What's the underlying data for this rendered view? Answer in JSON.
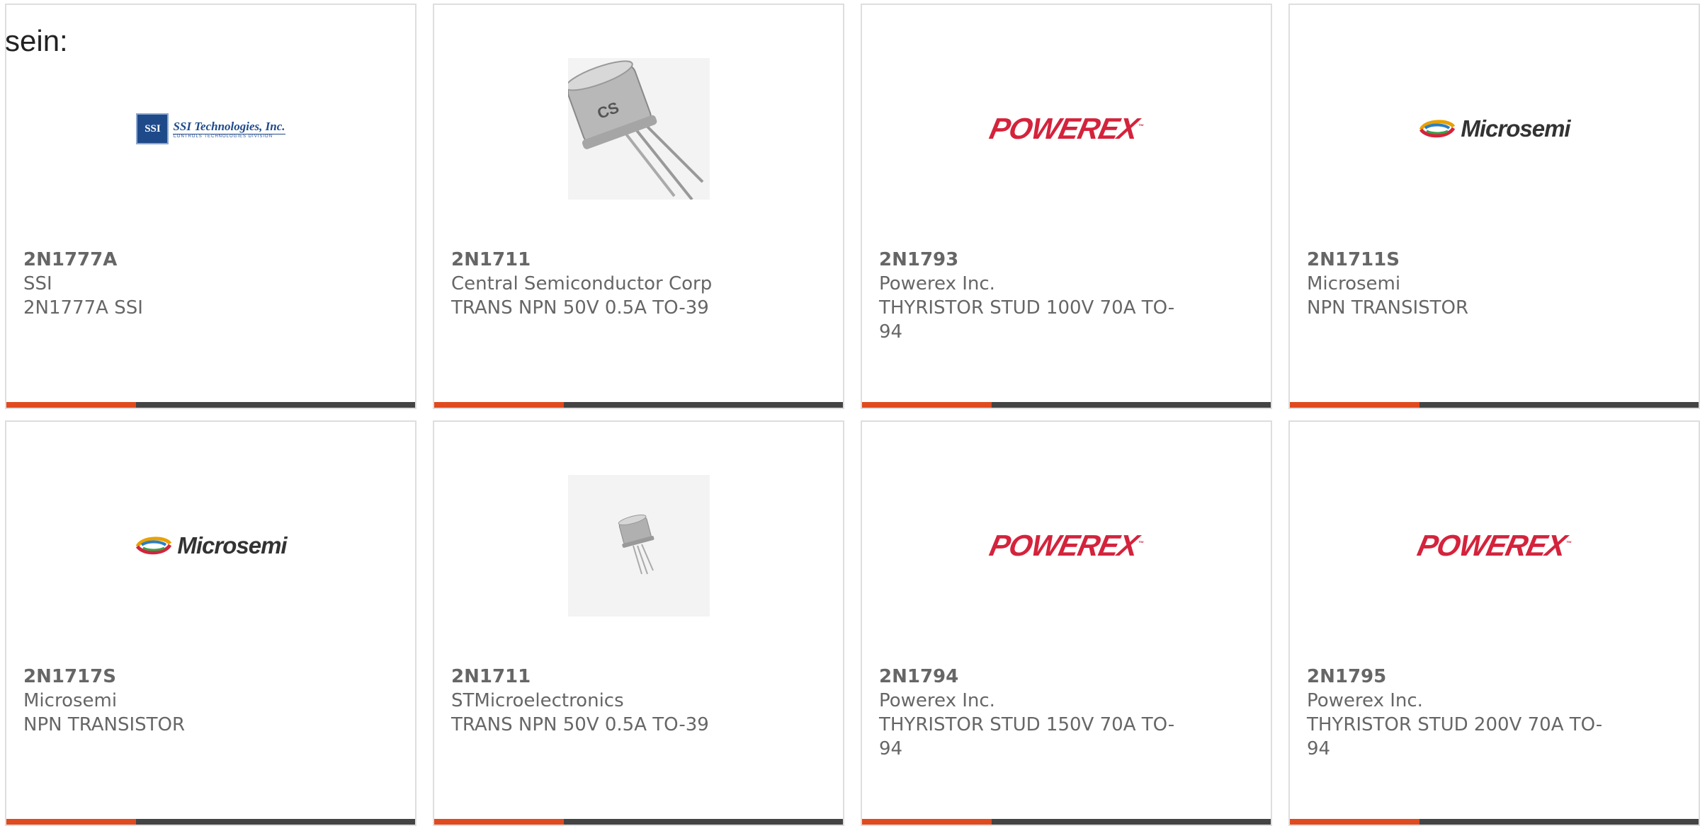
{
  "intro_text": "sein:",
  "colors": {
    "accent": "#e04a1f",
    "bar": "#444444",
    "card_border": "#dedede"
  },
  "products": [
    {
      "part": "2N1777A",
      "manufacturer": "SSI",
      "description": "2N1777A SSI",
      "image": "ssi-logo",
      "logo_text": "SSI Technologies, Inc.",
      "logo_sub": "CONTROLS TECHNOLOGIES DIVISION",
      "logo_mark": "SSI"
    },
    {
      "part": "2N1711",
      "manufacturer": "Central Semiconductor Corp",
      "description": "TRANS NPN 50V 0.5A TO-39",
      "image": "to39-photo-large"
    },
    {
      "part": "2N1793",
      "manufacturer": "Powerex Inc.",
      "description": "THYRISTOR STUD 100V 70A TO-94",
      "image": "powerex-logo",
      "logo_text": "POWEREX"
    },
    {
      "part": "2N1711S",
      "manufacturer": "Microsemi",
      "description": "NPN TRANSISTOR",
      "image": "microsemi-logo",
      "logo_text": "Microsemi"
    },
    {
      "part": "2N1717S",
      "manufacturer": "Microsemi",
      "description": "NPN TRANSISTOR",
      "image": "microsemi-logo",
      "logo_text": "Microsemi"
    },
    {
      "part": "2N1711",
      "manufacturer": "STMicroelectronics",
      "description": "TRANS NPN 50V 0.5A TO-39",
      "image": "to39-photo-small"
    },
    {
      "part": "2N1794",
      "manufacturer": "Powerex Inc.",
      "description": "THYRISTOR STUD 150V 70A TO-94",
      "image": "powerex-logo",
      "logo_text": "POWEREX"
    },
    {
      "part": "2N1795",
      "manufacturer": "Powerex Inc.",
      "description": "THYRISTOR STUD 200V 70A TO-94",
      "image": "powerex-logo",
      "logo_text": "POWEREX"
    }
  ]
}
